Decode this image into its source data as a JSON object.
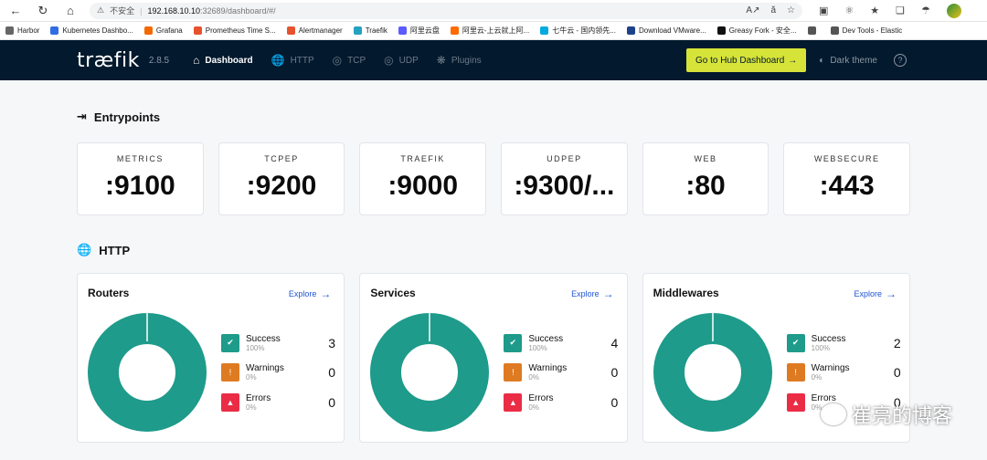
{
  "browser": {
    "security": "不安全",
    "url_host": "192.168.10.10",
    "url_path": ":32689/dashboard/#/",
    "bookmarks": [
      {
        "label": "Harbor",
        "color": "#666666"
      },
      {
        "label": "Kubernetes Dashbo...",
        "color": "#326ce5"
      },
      {
        "label": "Grafana",
        "color": "#f46800"
      },
      {
        "label": "Prometheus Time S...",
        "color": "#e6522c"
      },
      {
        "label": "Alertmanager",
        "color": "#e6522c"
      },
      {
        "label": "Traefik",
        "color": "#24a1c1"
      },
      {
        "label": "阿里云盘",
        "color": "#5b5bff"
      },
      {
        "label": "阿里云-上云就上阿...",
        "color": "#ff6a00"
      },
      {
        "label": "七牛云 - 国内领先...",
        "color": "#00a9e0"
      },
      {
        "label": "Download VMware...",
        "color": "#1d428a"
      },
      {
        "label": "Greasy Fork - 安全...",
        "color": "#111111"
      },
      {
        "label": "",
        "color": "#555555"
      },
      {
        "label": "Dev Tools - Elastic",
        "color": "#555555"
      }
    ]
  },
  "header": {
    "logo": "træfik",
    "version": "2.8.5",
    "nav": [
      {
        "label": "Dashboard",
        "icon": "home-icon",
        "active": true
      },
      {
        "label": "HTTP",
        "icon": "globe-icon",
        "active": false
      },
      {
        "label": "TCP",
        "icon": "tcp-icon",
        "active": false
      },
      {
        "label": "UDP",
        "icon": "udp-icon",
        "active": false
      },
      {
        "label": "Plugins",
        "icon": "plugins-icon",
        "active": false
      }
    ],
    "hub_button": "Go to Hub Dashboard",
    "theme_label": "Dark theme"
  },
  "entrypoints": {
    "title": "Entrypoints",
    "items": [
      {
        "name": "METRICS",
        "value": ":9100"
      },
      {
        "name": "TCPEP",
        "value": ":9200"
      },
      {
        "name": "TRAEFIK",
        "value": ":9000"
      },
      {
        "name": "UDPEP",
        "value": ":9300/..."
      },
      {
        "name": "WEB",
        "value": ":80"
      },
      {
        "name": "WEBSECURE",
        "value": ":443"
      }
    ]
  },
  "http": {
    "title": "HTTP",
    "explore_label": "Explore",
    "cards": [
      {
        "name": "Routers",
        "success": "3",
        "warnings": "0",
        "errors": "0",
        "success_pct": "100%",
        "warnings_pct": "0%",
        "errors_pct": "0%"
      },
      {
        "name": "Services",
        "success": "4",
        "warnings": "0",
        "errors": "0",
        "success_pct": "100%",
        "warnings_pct": "0%",
        "errors_pct": "0%"
      },
      {
        "name": "Middlewares",
        "success": "2",
        "warnings": "0",
        "errors": "0",
        "success_pct": "100%",
        "warnings_pct": "0%",
        "errors_pct": "0%"
      }
    ],
    "labels": {
      "success": "Success",
      "warnings": "Warnings",
      "errors": "Errors"
    }
  },
  "colors": {
    "success": "#1e9b8a",
    "warning": "#de7b22",
    "error": "#ea2d45",
    "nav_bg": "#03192d",
    "hub_btn": "#d6e339"
  },
  "watermark": "崔亮的博客"
}
